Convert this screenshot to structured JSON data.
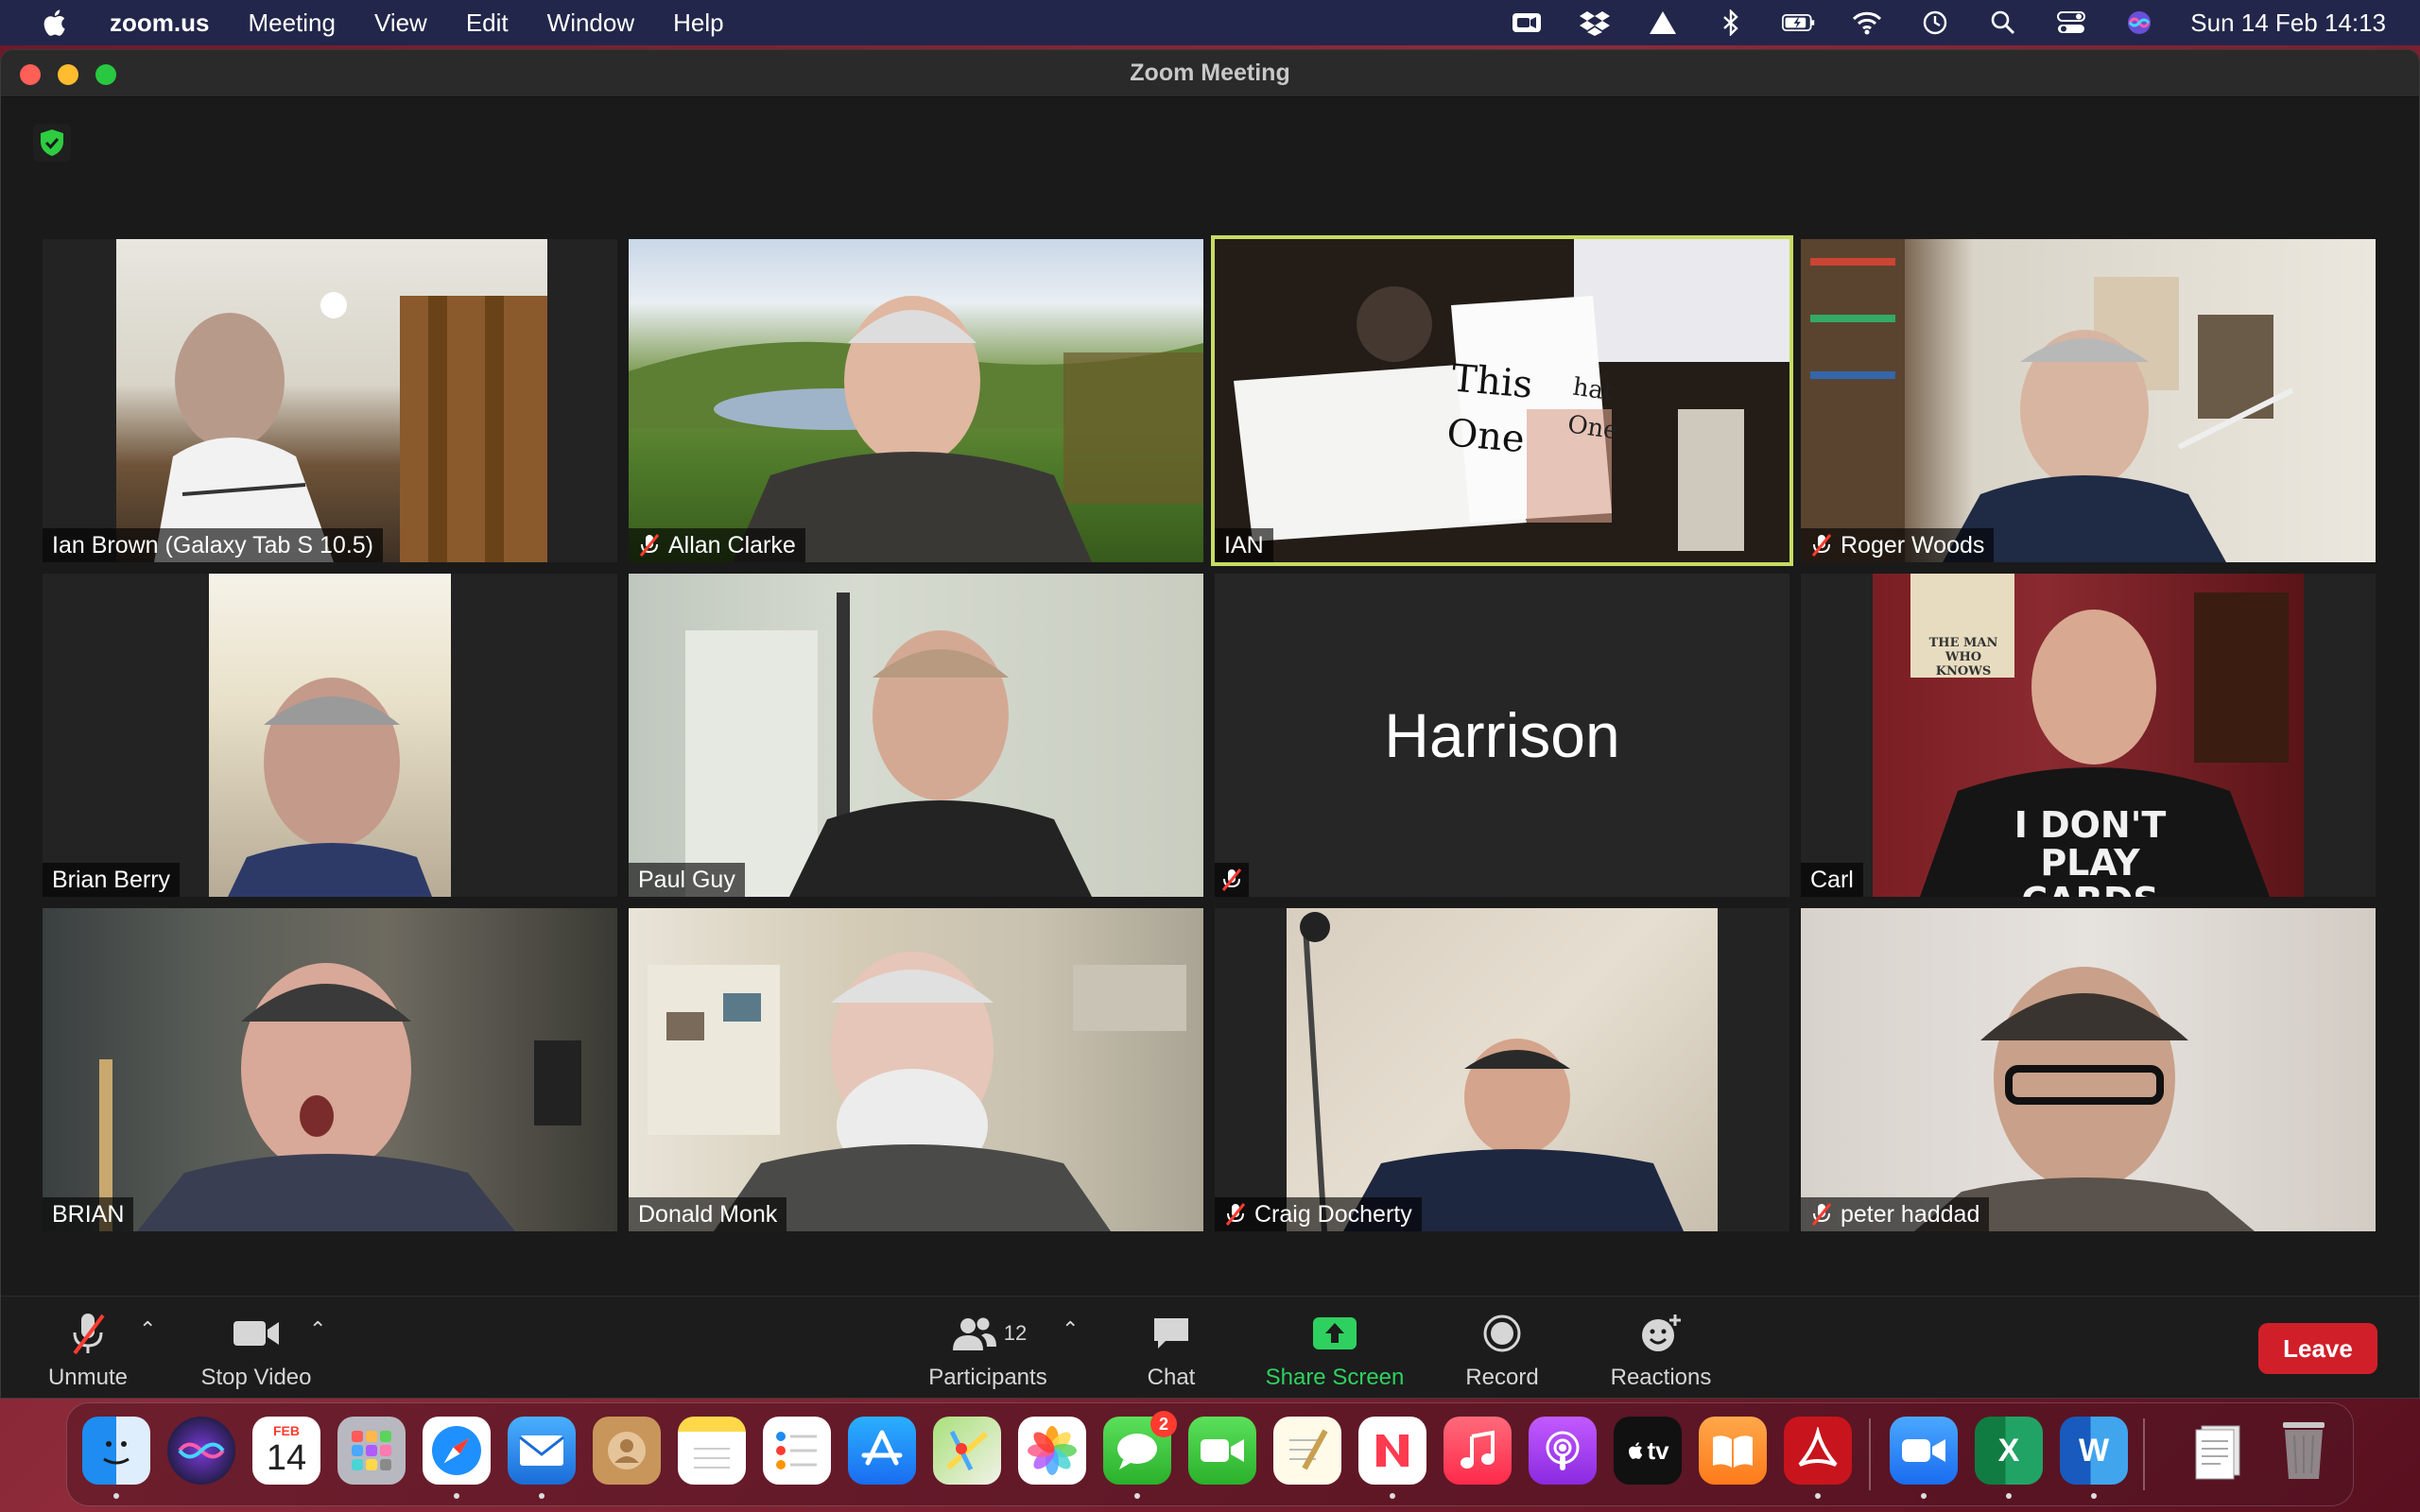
{
  "menubar": {
    "app_name": "zoom.us",
    "items": [
      "Meeting",
      "View",
      "Edit",
      "Window",
      "Help"
    ],
    "clock": "Sun 14 Feb  14:13"
  },
  "window": {
    "title": "Zoom Meeting"
  },
  "participants": [
    {
      "name": "Ian Brown (Galaxy Tab S 10.5)",
      "muted": false
    },
    {
      "name": "Allan Clarke",
      "muted": true
    },
    {
      "name": "IAN",
      "muted": false,
      "active_speaker": true,
      "shared_card_text": [
        "This",
        "One",
        "hat",
        "One"
      ]
    },
    {
      "name": "Roger Woods",
      "muted": true
    },
    {
      "name": "Brian Berry",
      "muted": false
    },
    {
      "name": "Paul Guy",
      "muted": false
    },
    {
      "name": "Harrison",
      "muted": true,
      "video_off": true
    },
    {
      "name": "Carl",
      "muted": false,
      "shirt_text": "I DON'T PLAY CARDS",
      "poster_text": "THE MAN WHO KNOWS"
    },
    {
      "name": "BRIAN",
      "muted": false
    },
    {
      "name": "Donald Monk",
      "muted": false
    },
    {
      "name": "Craig Docherty",
      "muted": true
    },
    {
      "name": "peter haddad",
      "muted": true
    }
  ],
  "toolbar": {
    "unmute": "Unmute",
    "stop_video": "Stop Video",
    "participants": "Participants",
    "participant_count": "12",
    "chat": "Chat",
    "share_screen": "Share Screen",
    "record": "Record",
    "reactions": "Reactions",
    "leave": "Leave"
  },
  "dock": {
    "calendar_month": "FEB",
    "calendar_day": "14",
    "messages_badge": "2",
    "tv_label": "tv",
    "excel_label": "X",
    "word_label": "W"
  },
  "colors": {
    "active_speaker_border": "#c7dc62",
    "share_green": "#2ed15f",
    "leave_red": "#d11f2a",
    "menubar_bg": "#22264a"
  }
}
